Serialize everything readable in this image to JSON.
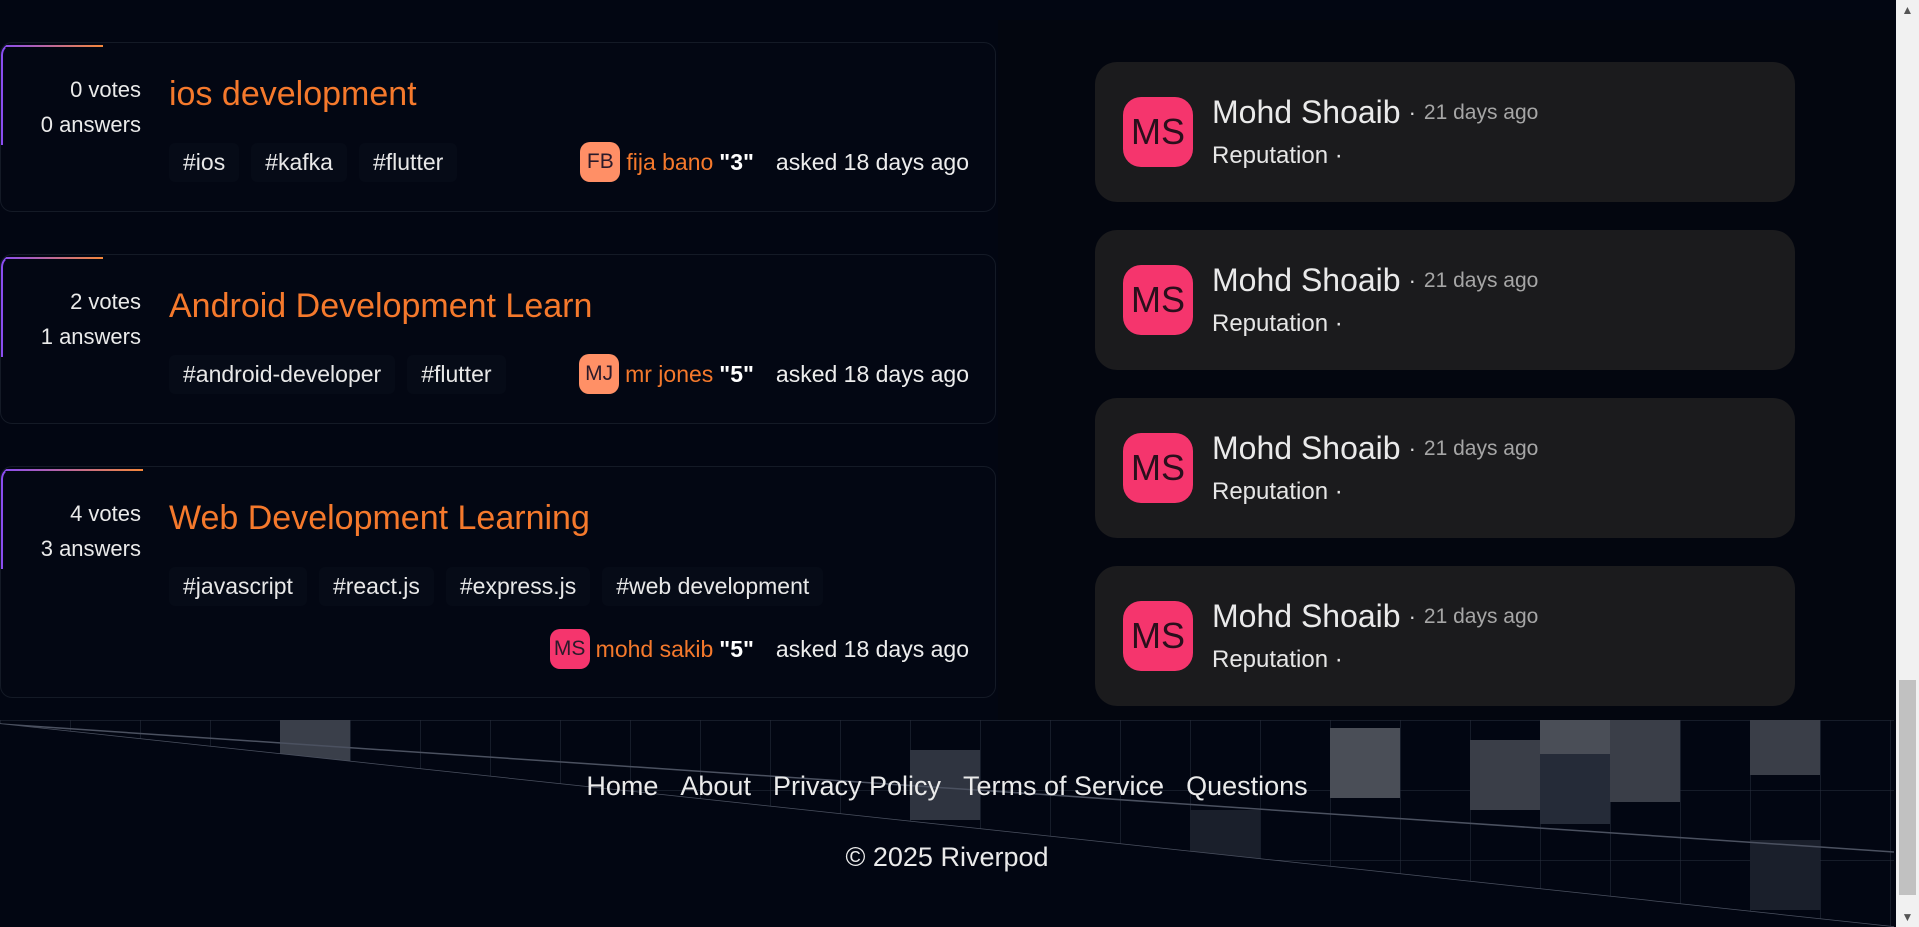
{
  "questions": [
    {
      "votes": "0 votes",
      "answers": "0 answers",
      "title": "ios development",
      "tags": [
        "#ios",
        "#kafka",
        "#flutter"
      ],
      "asker": {
        "initials": "FB",
        "name": "fija bano",
        "rep": "\"3\"",
        "avatar_color": "#ff8f66"
      },
      "asked": "asked 18 days ago"
    },
    {
      "votes": "2 votes",
      "answers": "1 answers",
      "title": "Android Development Learn",
      "tags": [
        "#android-developer",
        "#flutter"
      ],
      "asker": {
        "initials": "MJ",
        "name": "mr jones",
        "rep": "\"5\"",
        "avatar_color": "#ff9066"
      },
      "asked": "asked 18 days ago"
    },
    {
      "votes": "4 votes",
      "answers": "3 answers",
      "title": "Web Development Learning",
      "tags": [
        "#javascript",
        "#react.js",
        "#express.js",
        "#web development"
      ],
      "asker": {
        "initials": "MS",
        "name": "mohd sakib",
        "rep": "\"5\"",
        "avatar_color": "#f5356d"
      },
      "asked": "asked 18 days ago"
    }
  ],
  "users": [
    {
      "initials": "MS",
      "name": "Mohd Shoaib",
      "dot": "·",
      "ago": "21 days ago",
      "reputation": "Reputation ·"
    },
    {
      "initials": "MS",
      "name": "Mohd Shoaib",
      "dot": "·",
      "ago": "21 days ago",
      "reputation": "Reputation ·"
    },
    {
      "initials": "MS",
      "name": "Mohd Shoaib",
      "dot": "·",
      "ago": "21 days ago",
      "reputation": "Reputation ·"
    },
    {
      "initials": "MS",
      "name": "Mohd Shoaib",
      "dot": "·",
      "ago": "21 days ago",
      "reputation": "Reputation ·"
    }
  ],
  "footer": {
    "links": [
      "Home",
      "About",
      "Privacy Policy",
      "Terms of Service",
      "Questions"
    ],
    "copyright": "© 2025 Riverpod"
  },
  "colors": {
    "accent_orange": "#f5792c",
    "accent_purple": "#8a4df0",
    "avatar_pink": "#f5356d",
    "background": "#020612",
    "card_dark": "#1b1b1d"
  }
}
